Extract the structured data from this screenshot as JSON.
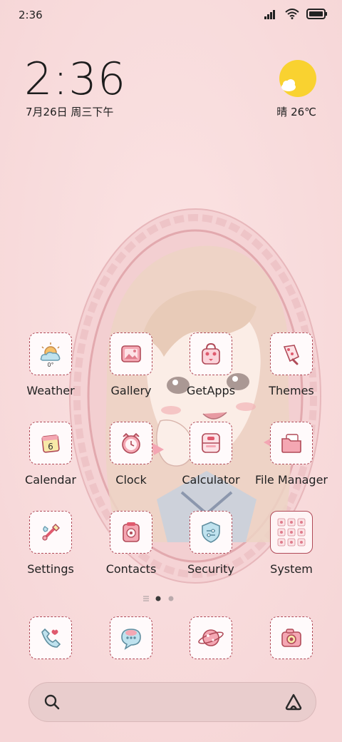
{
  "status_bar": {
    "time": "2:36"
  },
  "clock_widget": {
    "time": "2:36",
    "date": "7月26日 周三下午"
  },
  "weather_widget": {
    "text": "晴 26℃"
  },
  "apps": [
    {
      "label": "Weather",
      "icon": "weather-icon",
      "badge": "0°"
    },
    {
      "label": "Gallery",
      "icon": "gallery-icon"
    },
    {
      "label": "GetApps",
      "icon": "getapps-icon"
    },
    {
      "label": "Themes",
      "icon": "themes-icon"
    },
    {
      "label": "Calendar",
      "icon": "calendar-icon",
      "badge": "6"
    },
    {
      "label": "Clock",
      "icon": "clock-icon"
    },
    {
      "label": "Calculator",
      "icon": "calculator-icon"
    },
    {
      "label": "File Manager",
      "icon": "file-manager-icon"
    },
    {
      "label": "Settings",
      "icon": "settings-icon"
    },
    {
      "label": "Contacts",
      "icon": "contacts-icon"
    },
    {
      "label": "Security",
      "icon": "security-icon"
    },
    {
      "label": "System",
      "icon": "system-folder-icon"
    }
  ],
  "dock": [
    {
      "icon": "phone-icon"
    },
    {
      "icon": "messages-icon"
    },
    {
      "icon": "browser-icon"
    },
    {
      "icon": "camera-icon"
    }
  ],
  "page_indicator": {
    "pages": 2,
    "current": 1
  },
  "colors": {
    "background": "#f8dadb",
    "icon_border": "#b04a58",
    "accent_pink": "#e9a3ae",
    "sun": "#f9d230"
  }
}
